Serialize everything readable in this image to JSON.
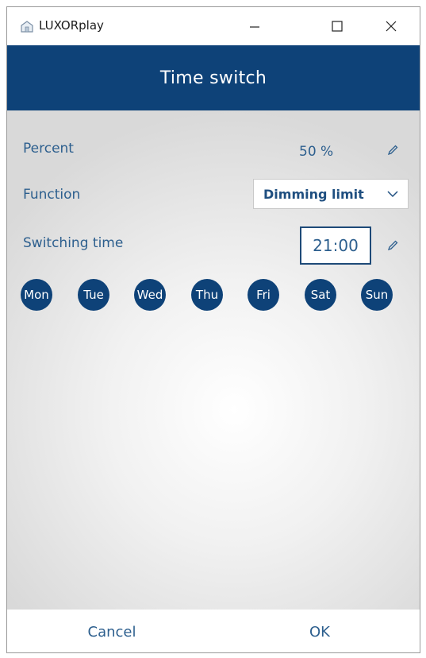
{
  "window": {
    "title": "LUXORplay",
    "min_symbol": "—",
    "max_symbol": "☐",
    "close_symbol": "✕"
  },
  "header": {
    "title": "Time switch"
  },
  "form": {
    "percent_label": "Percent",
    "percent_value": "50 %",
    "function_label": "Function",
    "function_value": "Dimming limit",
    "switching_time_label": "Switching time",
    "switching_time_value": "21:00"
  },
  "days": [
    "Mon",
    "Tue",
    "Wed",
    "Thu",
    "Fri",
    "Sat",
    "Sun"
  ],
  "footer": {
    "cancel_label": "Cancel",
    "ok_label": "OK"
  },
  "colors": {
    "accent": "#0e4278",
    "text": "#2d5f8e"
  },
  "icons": [
    "home-icon",
    "edit-pencil-icon",
    "chevron-down-icon"
  ]
}
